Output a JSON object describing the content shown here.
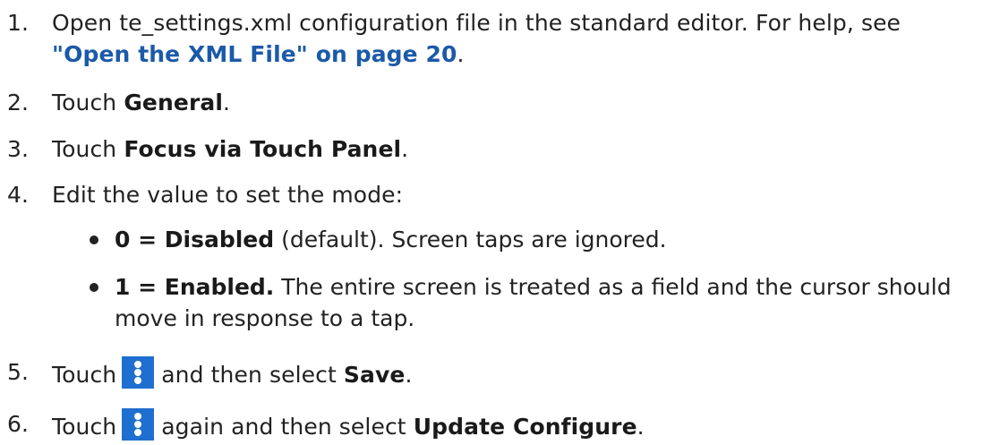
{
  "steps": [
    {
      "num": "1.",
      "text_a": "Open te_settings.xml configuration file in the standard editor. For help, see",
      "link": "\"Open the XML File\" on page 20",
      "text_b": "."
    },
    {
      "num": "2.",
      "text_a": "Touch ",
      "bold": "General",
      "text_b": "."
    },
    {
      "num": "3.",
      "text_a": "Touch ",
      "bold": "Focus via Touch Panel",
      "text_b": "."
    },
    {
      "num": "4.",
      "text_a": "Edit the value to set the mode:"
    },
    {
      "num": "5.",
      "text_a": "Touch",
      "text_b": "and then select ",
      "bold": "Save",
      "text_c": "."
    },
    {
      "num": "6.",
      "text_a": "Touch",
      "text_b": "again and then select ",
      "bold": "Update Configure",
      "text_c": "."
    }
  ],
  "bullets": [
    {
      "bold": "0 = Disabled",
      "text": " (default). Screen taps are ignored."
    },
    {
      "bold": "1 = Enabled.",
      "text": " The entire screen is treated as a field and the cursor should",
      "text2": "move in response to a tap."
    }
  ],
  "icons": {
    "menu": "more-vert-icon",
    "menu_color": "#1e6fd0"
  },
  "colors": {
    "link": "#1c5aa8",
    "text": "#222222"
  }
}
